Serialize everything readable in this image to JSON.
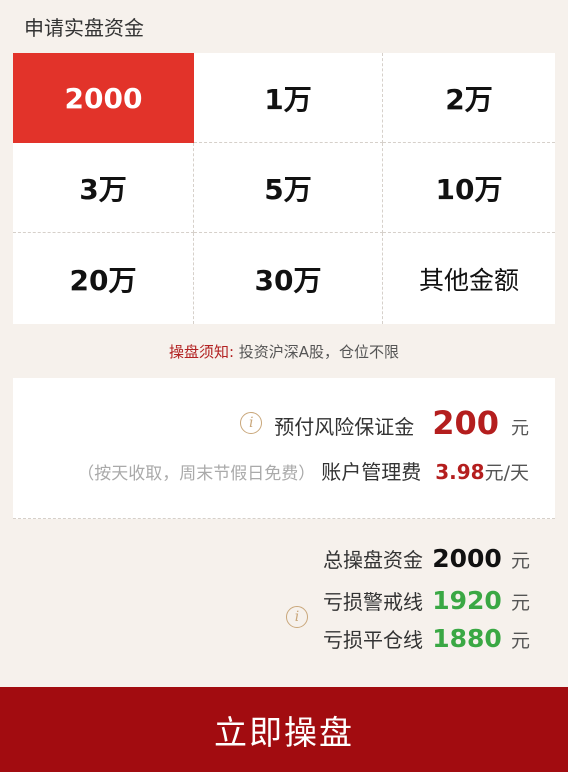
{
  "section_title": "申请实盘资金",
  "amounts": [
    {
      "label": "2000",
      "selected": true
    },
    {
      "label": "1万"
    },
    {
      "label": "2万"
    },
    {
      "label": "3万"
    },
    {
      "label": "5万"
    },
    {
      "label": "10万"
    },
    {
      "label": "20万"
    },
    {
      "label": "30万"
    },
    {
      "label": "其他金额",
      "other": true
    }
  ],
  "notice": {
    "lead": "操盘须知:",
    "text": "投资沪深A股，仓位不限"
  },
  "deposit": {
    "label": "预付风险保证金",
    "value": "200",
    "unit": "元"
  },
  "fee": {
    "hint": "（按天收取，周末节假日免费）",
    "label": "账户管理费",
    "value": "3.98",
    "unit": "元/天"
  },
  "summary": {
    "total": {
      "label": "总操盘资金",
      "value": "2000",
      "unit": "元"
    },
    "warning": {
      "label": "亏损警戒线",
      "value": "1920",
      "unit": "元"
    },
    "liquidation": {
      "label": "亏损平仓线",
      "value": "1880",
      "unit": "元"
    }
  },
  "cta": "立即操盘",
  "icons": {
    "info": "info-icon"
  },
  "colors": {
    "selected": "#e2332a",
    "cta": "#a20c10",
    "green": "#3aa844",
    "red": "#b41e1e"
  }
}
